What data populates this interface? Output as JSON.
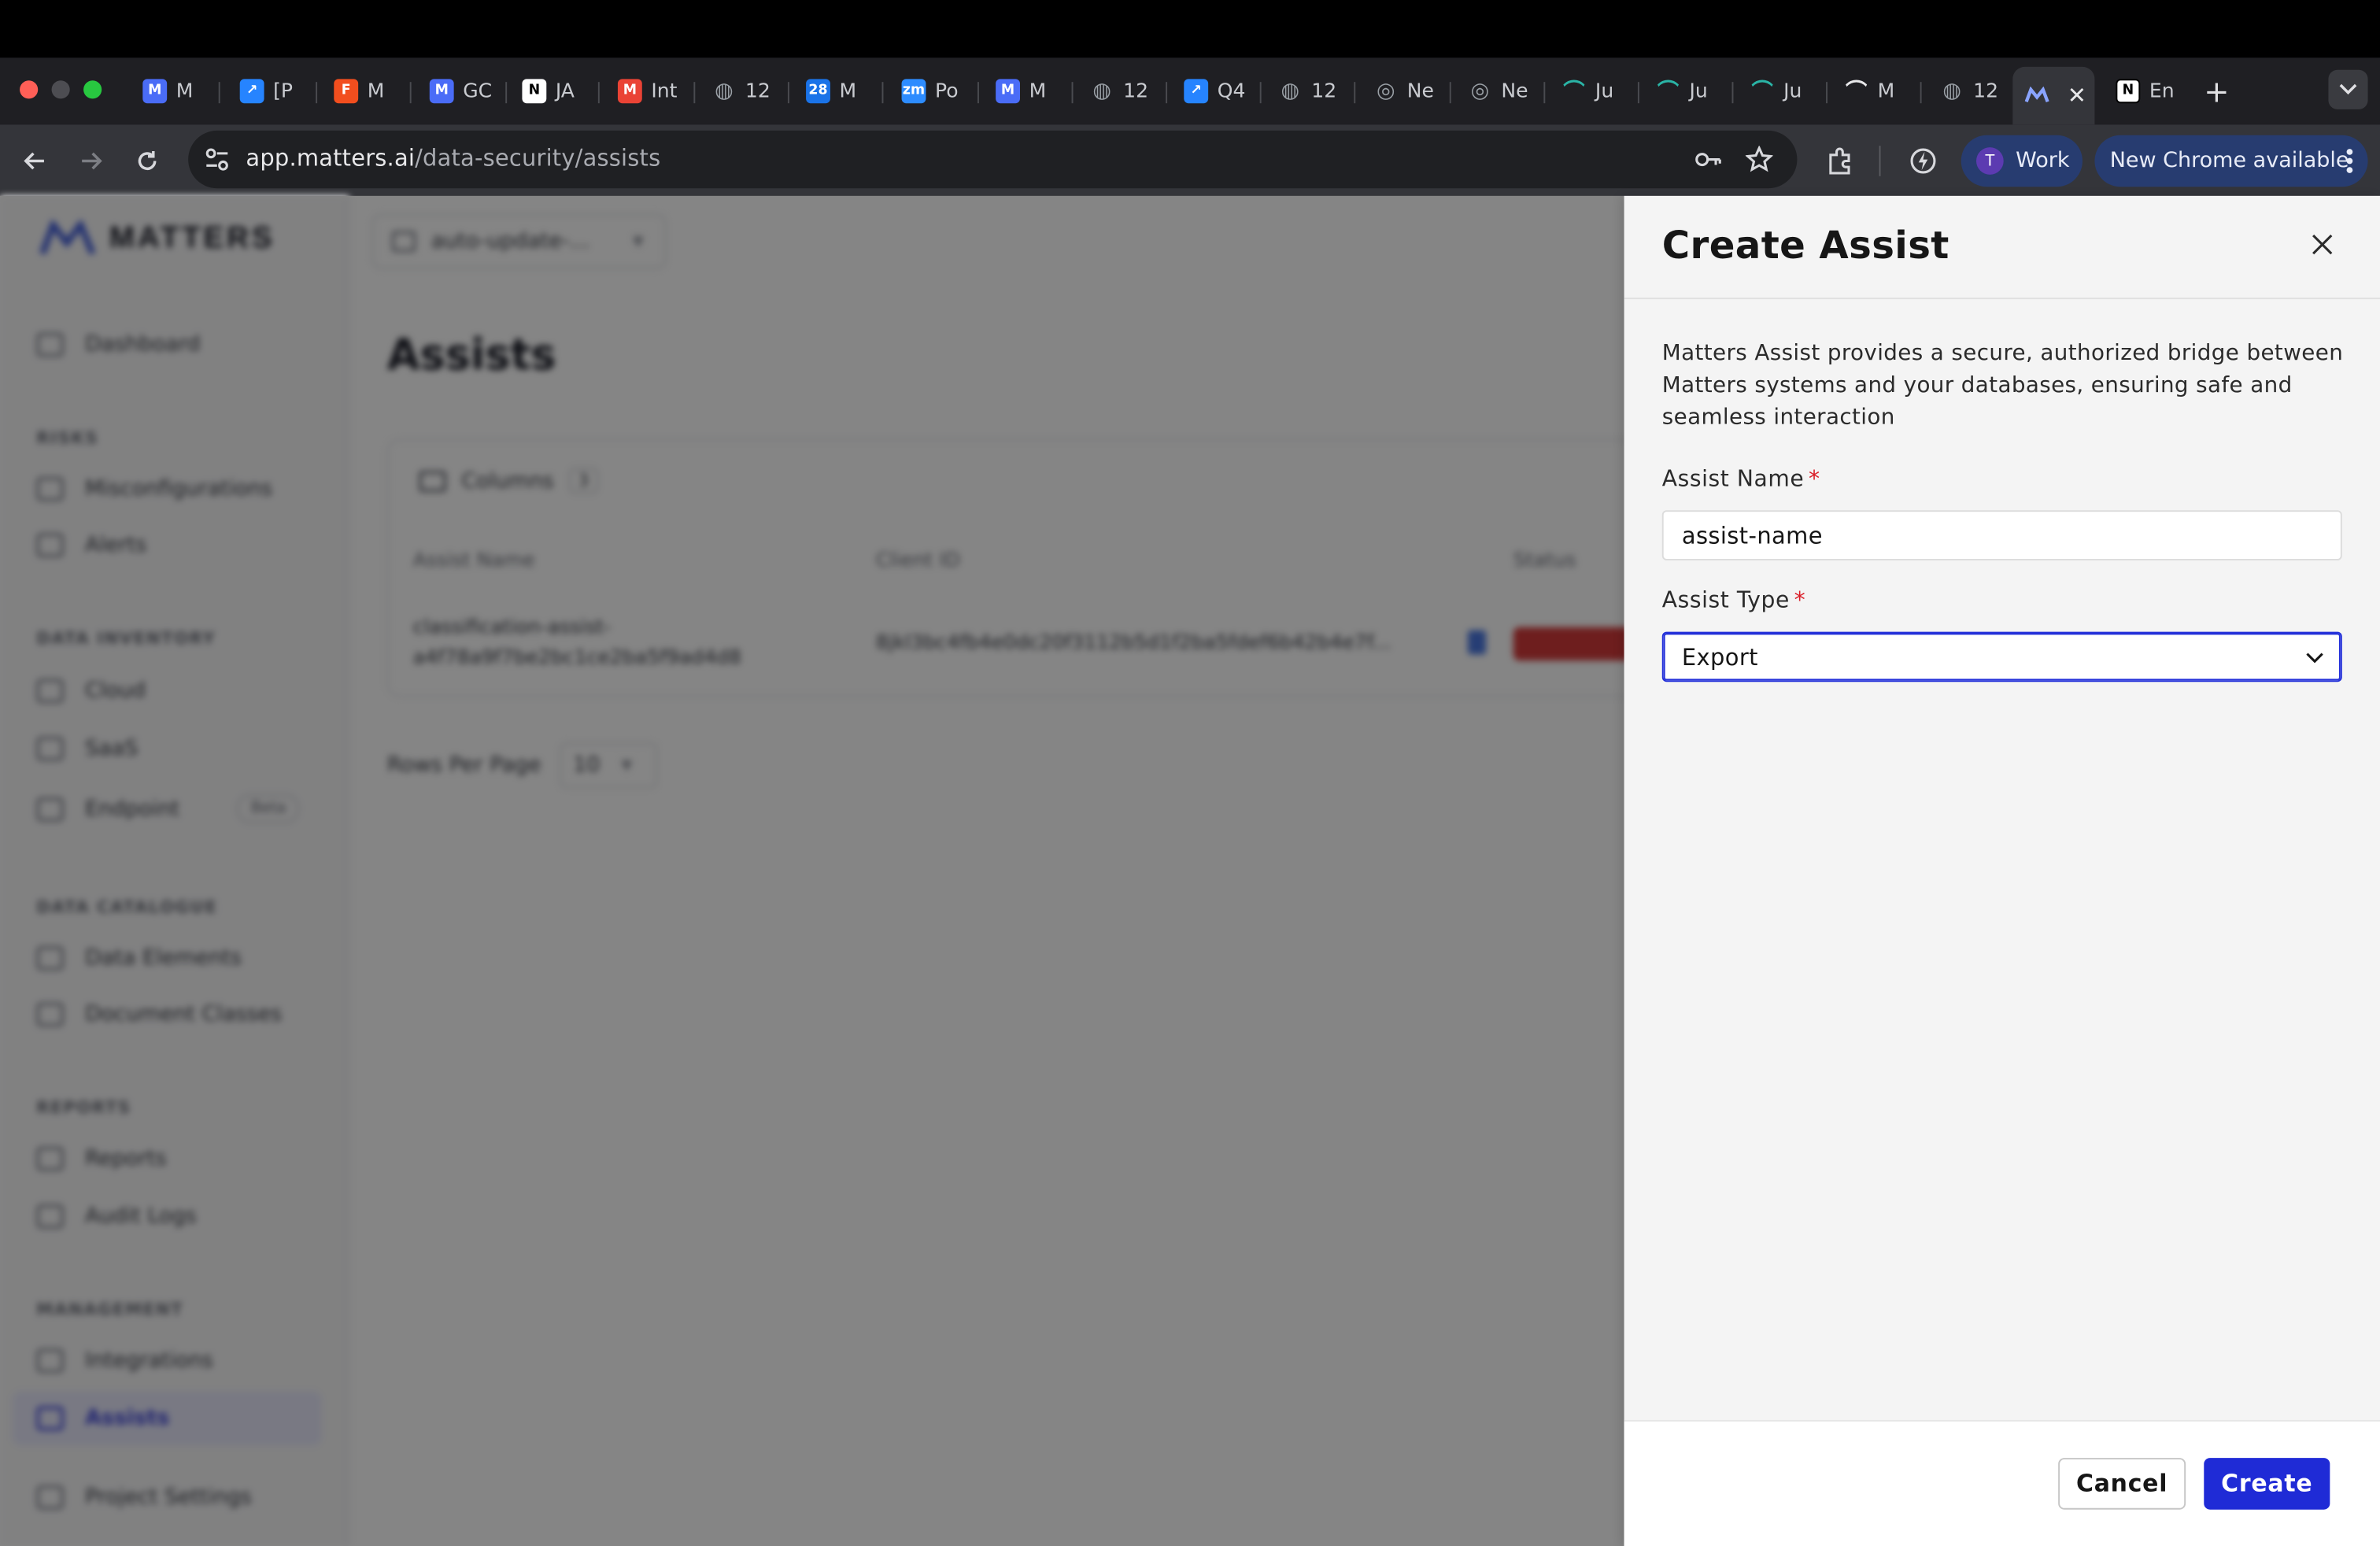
{
  "browser": {
    "tabs": [
      {
        "label": "M",
        "icon": "matters-icon",
        "color": "#4a6cf7"
      },
      {
        "label": "[P",
        "icon": "jira-icon",
        "color": "#2684ff"
      },
      {
        "label": "M",
        "icon": "figma-icon",
        "color": "#f24e1e"
      },
      {
        "label": "GC",
        "icon": "matters-icon",
        "color": "#4a6cf7"
      },
      {
        "label": "JA",
        "icon": "notion-icon",
        "color": "#ffffff"
      },
      {
        "label": "Int",
        "icon": "gmail-icon",
        "color": "#ea4335"
      },
      {
        "label": "12",
        "icon": "globe-icon",
        "color": "#9aa0a6"
      },
      {
        "label": "M",
        "icon": "calendar-icon",
        "color": "#1a73e8"
      },
      {
        "label": "Po",
        "icon": "zoom-icon",
        "color": "#2d8cff"
      },
      {
        "label": "M",
        "icon": "matters-icon",
        "color": "#4a6cf7"
      },
      {
        "label": "12",
        "icon": "globe-icon",
        "color": "#9aa0a6"
      },
      {
        "label": "Q4",
        "icon": "jira-icon",
        "color": "#2684ff"
      },
      {
        "label": "12",
        "icon": "globe-icon",
        "color": "#9aa0a6"
      },
      {
        "label": "Ne",
        "icon": "chrome-icon",
        "color": "#9aa0a6"
      },
      {
        "label": "Ne",
        "icon": "chrome-icon",
        "color": "#9aa0a6"
      },
      {
        "label": "Ju",
        "icon": "jupyter-icon",
        "color": "#2ab4a6"
      },
      {
        "label": "Ju",
        "icon": "jupyter-icon",
        "color": "#2ab4a6"
      },
      {
        "label": "Ju",
        "icon": "jupyter-icon",
        "color": "#2ab4a6"
      },
      {
        "label": "M",
        "icon": "jupyter-icon",
        "color": "#e8e8ea"
      },
      {
        "label": "12",
        "icon": "globe-icon",
        "color": "#9aa0a6"
      }
    ],
    "active_tab_icon": "matters-icon",
    "last_tab": {
      "label": "En",
      "icon": "notion-icon"
    },
    "url_host": "app.matters.ai",
    "url_path": "/data-security/assists",
    "profile_initial": "T",
    "profile_label": "Work",
    "update_label": "New Chrome available"
  },
  "app": {
    "logo_text": "MATTERS",
    "project_selector": "auto-update-...",
    "page_title": "Assists",
    "sidebar": {
      "dashboard": "Dashboard",
      "section_risks": "RISKS",
      "misconfigurations": "Misconfigurations",
      "alerts": "Alerts",
      "section_inventory": "DATA INVENTORY",
      "cloud": "Cloud",
      "saas": "SaaS",
      "endpoint": "Endpoint",
      "endpoint_badge": "Beta",
      "section_catalogue": "DATA CATALOGUE",
      "data_elements": "Data Elements",
      "document_classes": "Document Classes",
      "section_reports": "REPORTS",
      "reports": "Reports",
      "audit_logs": "Audit Logs",
      "section_management": "MANAGEMENT",
      "integrations": "Integrations",
      "assists": "Assists",
      "project_settings": "Project Settings"
    },
    "table": {
      "columns_button": "Columns",
      "columns_count": "3",
      "headers": [
        "Assist Name",
        "Client ID",
        "Status"
      ],
      "row": {
        "name_line1": "classification-assist-",
        "name_line2": "a4f78a9f7be2bc1ce2ba5f9ad4d8",
        "client_id": "8jkl3bc4fb4e0dc20f3112b5d1f2ba5fdef6b42b4e7f..."
      },
      "rows_per_page_label": "Rows Per Page",
      "rows_per_page_value": "10"
    }
  },
  "drawer": {
    "title": "Create Assist",
    "description": "Matters Assist provides a secure, authorized bridge between Matters systems and your databases, ensuring safe and seamless interaction",
    "name_label": "Assist Name",
    "name_value": "assist-name",
    "type_label": "Assist Type",
    "type_value": "Export",
    "required_mark": "*",
    "cancel_label": "Cancel",
    "create_label": "Create",
    "accent_color": "#1f2bd6",
    "required_color": "#da1e28"
  }
}
